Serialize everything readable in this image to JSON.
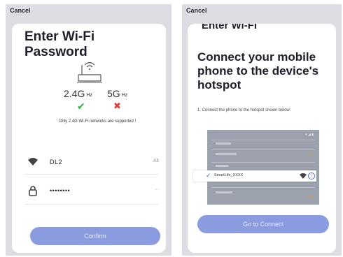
{
  "left_screen": {
    "cancel_label": "Cancel",
    "title": "Enter Wi-Fi Password",
    "bands": [
      {
        "label": "2.4G",
        "unit": "Hz",
        "supported": true
      },
      {
        "label": "5G",
        "unit": "Hz",
        "supported": false
      }
    ],
    "supported_icon": "✔",
    "unsupported_icon": "✖",
    "note": "Only 2.4G Wi-Fi networks are supported !",
    "wifi_field": {
      "value": "DL2",
      "action": "Alt"
    },
    "password_field": {
      "value": "••••••••",
      "action": "···"
    },
    "confirm_label": "Confirm"
  },
  "right_screen": {
    "cancel_label": "Cancel",
    "partial_title": "Enter Wi-Fi",
    "title": "Connect your mobile phone to the device's hotspot",
    "step": "1. Connect the phone to the hotspot shown below:",
    "hotspot_ssid": "SmartLife_XXXX",
    "connect_label": "Go to Connect"
  },
  "colors": {
    "panel_bg": "#dcdde2",
    "button_bg": "#8a9be0",
    "check_green": "#33aa44",
    "cross_red": "#e03a3a",
    "accent_blue": "#4a6fd8"
  },
  "icons": {
    "router": "router-icon",
    "wifi": "wifi-icon",
    "lock": "lock-icon",
    "check": "check-icon",
    "cross": "cross-icon",
    "info": "info-icon"
  }
}
